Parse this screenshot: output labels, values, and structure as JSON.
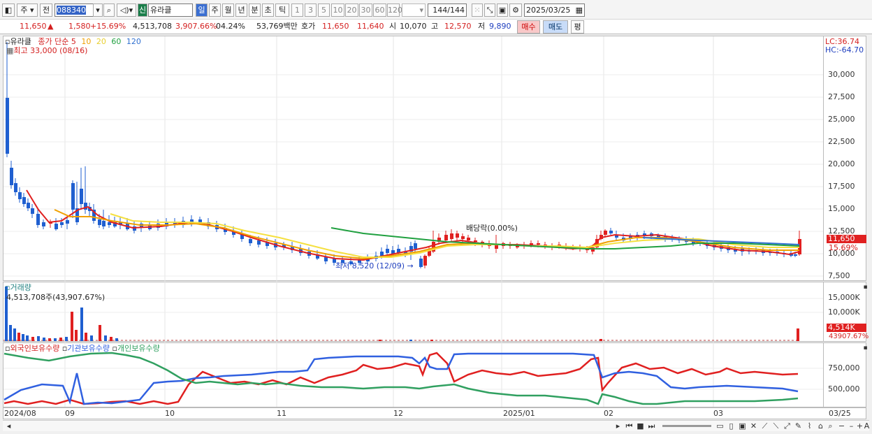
{
  "toolbar": {
    "type": "주",
    "prev": "전",
    "code": "088340",
    "name": "유라클",
    "sin": "신",
    "periods": [
      "일",
      "주",
      "월",
      "년",
      "분",
      "초",
      "틱"
    ],
    "active_period": "일",
    "ticks": [
      "1",
      "3",
      "5",
      "10",
      "20",
      "30",
      "60",
      "120"
    ],
    "count": "144",
    "count_total": "/144",
    "date": "2025/03/25"
  },
  "quote": {
    "price": "11,650",
    "arrow": "▲",
    "change": "1,580",
    "pct": "+15.69%",
    "volume": "4,513,708",
    "vol_ratio": "3,907.66%",
    "turnover": "04.24%",
    "amount": "53,769백만",
    "hoga_label": "호가",
    "ask": "11,650",
    "bid": "11,640",
    "open_label": "시",
    "open": "10,070",
    "high_label": "고",
    "high": "12,570",
    "low_label": "저",
    "low": "9,890",
    "buy": "매수",
    "sell": "매도",
    "avg": "평"
  },
  "price_pane": {
    "legend_name": "유라클",
    "legend_ma": "종가 단순",
    "ma_periods": [
      "5",
      "10",
      "20",
      "60",
      "120"
    ],
    "high_note": "최고 33,000 (08/16)",
    "low_note": "최저 8,520 (12/09)",
    "dividend_note": "배당락(0.00%)",
    "lc": "LC:36.74",
    "hc": "HC:-64.70",
    "y_ticks": [
      "30,000",
      "27,500",
      "25,000",
      "22,500",
      "20,000",
      "17,500",
      "15,000",
      "12,500",
      "10,000",
      "7,500"
    ],
    "price_tag": "11,650",
    "pct_tag": "15.69%"
  },
  "volume_pane": {
    "title": "거래량",
    "value": "4,513,708주(43,907.67%)",
    "y_ticks": [
      "15,000K",
      "10,000K"
    ],
    "vol_tag": "4,514K",
    "pct_tag": "43907.67%"
  },
  "holding_pane": {
    "series": [
      "외국인보유수량",
      "기관보유수량",
      "개인보유수량"
    ],
    "y_ticks": [
      "750,000",
      "500,000"
    ]
  },
  "x_axis": [
    "2024/08",
    "09",
    "10",
    "11",
    "12",
    "2025/01",
    "02",
    "03",
    "03/25"
  ],
  "colors": {
    "up": "#e02020",
    "down": "#1f5fd0",
    "ma5": "#e02020",
    "ma10": "#f0a000",
    "ma20": "#f5e040",
    "ma60": "#20a040",
    "ma120": "#3070d0",
    "foreign": "#e02020",
    "inst": "#3060e0",
    "indiv": "#30a060"
  }
}
